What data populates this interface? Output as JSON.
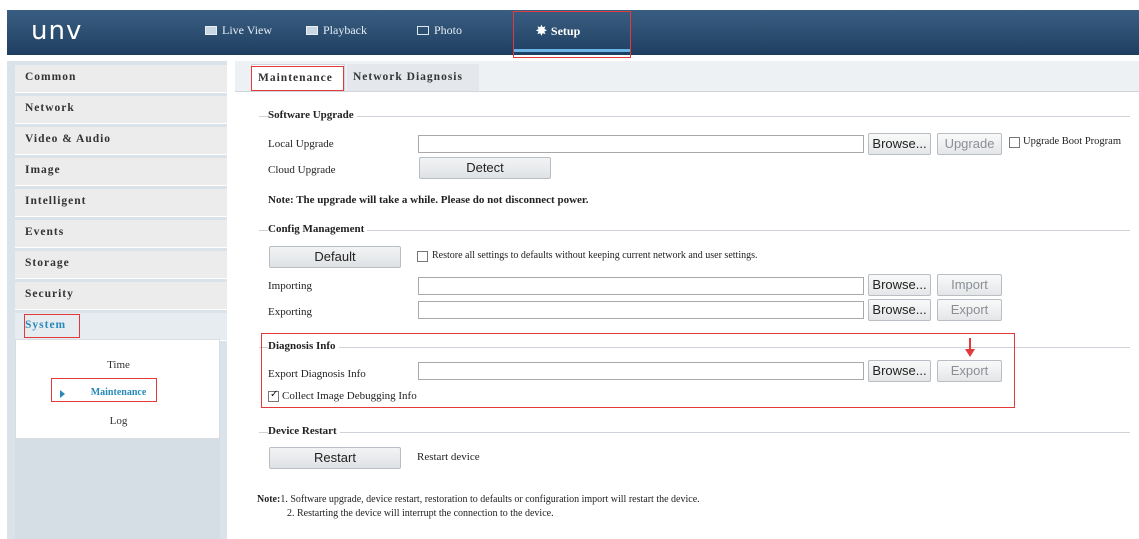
{
  "app": {
    "logo": "unv",
    "nav": [
      {
        "label": "Live View",
        "icon": "monitor-icon"
      },
      {
        "label": "Playback",
        "icon": "playback-icon"
      },
      {
        "label": "Photo",
        "icon": "photo-icon"
      },
      {
        "label": "Setup",
        "icon": "gear-icon"
      }
    ]
  },
  "sidebar": {
    "items": [
      {
        "label": "Common"
      },
      {
        "label": "Network"
      },
      {
        "label": "Video & Audio"
      },
      {
        "label": "Image"
      },
      {
        "label": "Intelligent"
      },
      {
        "label": "Events"
      },
      {
        "label": "Storage"
      },
      {
        "label": "Security"
      },
      {
        "label": "System"
      }
    ],
    "system_sub": [
      {
        "label": "Time"
      },
      {
        "label": "Maintenance"
      },
      {
        "label": "Log"
      }
    ]
  },
  "tabs": [
    {
      "label": "Maintenance"
    },
    {
      "label": "Network Diagnosis"
    }
  ],
  "software_upgrade": {
    "legend": "Software Upgrade",
    "local_label": "Local Upgrade",
    "local_value": "",
    "browse": "Browse...",
    "upgrade": "Upgrade",
    "boot_label": "Upgrade Boot Program",
    "boot_checked": false,
    "cloud_label": "Cloud Upgrade",
    "detect": "Detect",
    "note": "Note: The upgrade will take a while. Please do not disconnect power."
  },
  "config": {
    "legend": "Config Management",
    "default_btn": "Default",
    "restore_label": "Restore all settings to defaults without keeping current network and user settings.",
    "importing_label": "Importing",
    "importing_value": "",
    "browse": "Browse...",
    "import_btn": "Import",
    "exporting_label": "Exporting",
    "exporting_value": "",
    "export_btn": "Export"
  },
  "diagnosis": {
    "legend": "Diagnosis Info",
    "export_label": "Export Diagnosis Info",
    "export_value": "",
    "browse": "Browse...",
    "export_btn": "Export",
    "collect_label": "Collect Image Debugging Info",
    "collect_checked": true
  },
  "restart": {
    "legend": "Device Restart",
    "restart_btn": "Restart",
    "restart_desc": "Restart device"
  },
  "footer_note": {
    "prefix": "Note:",
    "line1": "1. Software upgrade, device restart, restoration to defaults or configuration import will restart the device.",
    "line2": "2. Restarting the device will interrupt the connection to the device."
  },
  "colors": {
    "nav_bg": "#2b4c70",
    "accent": "#2a89b9",
    "highlight": "#e23a3a"
  }
}
